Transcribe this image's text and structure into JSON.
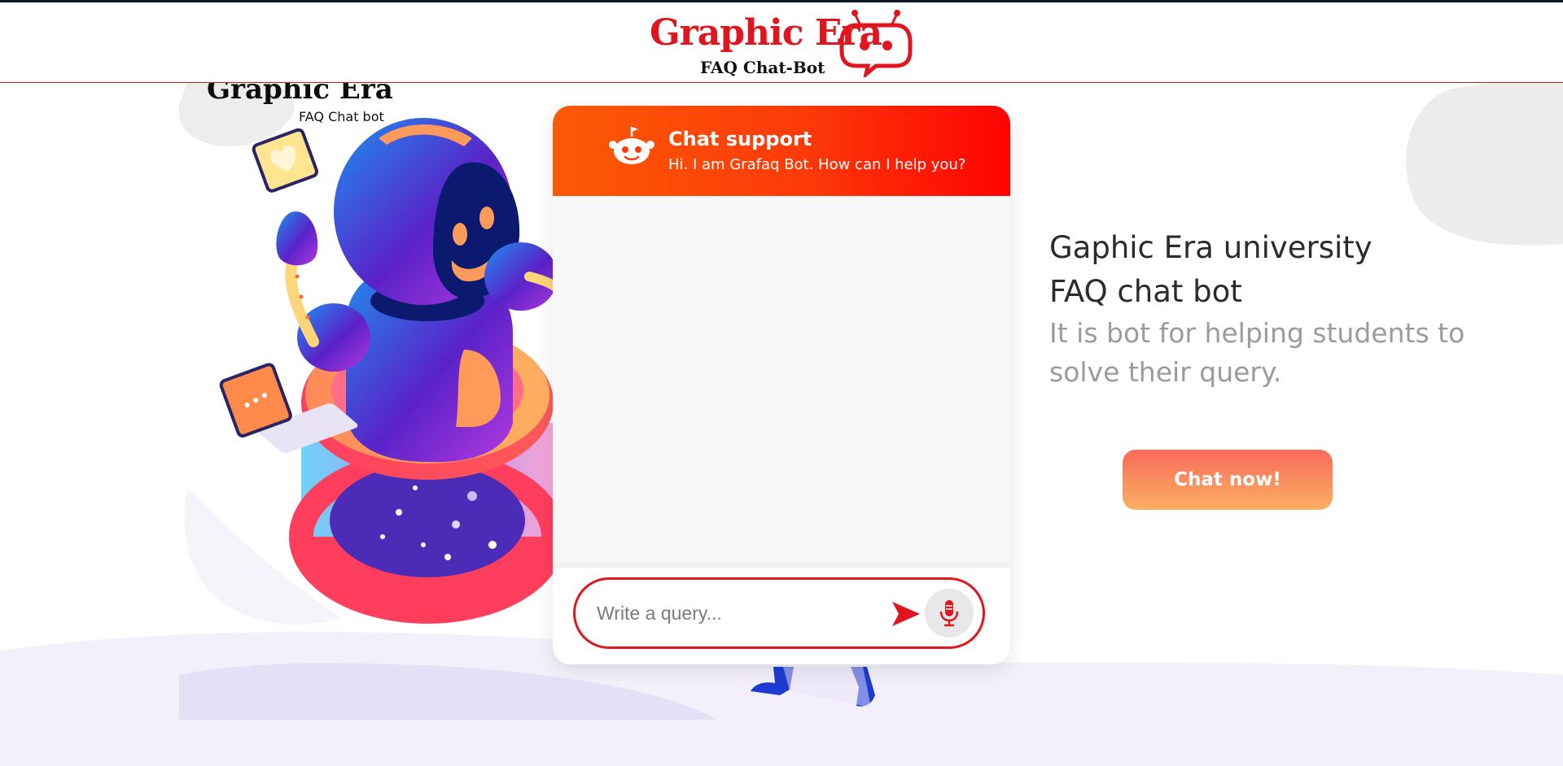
{
  "header": {
    "logo_title": "Graphic Era",
    "logo_subtitle": "FAQ Chat-Bot",
    "brand_color": "#e0151e"
  },
  "illustration": {
    "title": "Graphic Era",
    "subtitle": "FAQ Chat bot"
  },
  "chat": {
    "title": "Chat support",
    "greeting": "Hi. I am Grafaq Bot. How can I help you?",
    "input_placeholder": "Write a query...",
    "header_gradient": [
      "#fb5a06",
      "#ff0202"
    ],
    "send_icon": "send-icon",
    "mic_icon": "microphone-icon",
    "bot_icon": "robot-face-icon"
  },
  "info": {
    "title_line1": "Gaphic Era university",
    "title_line2": "FAQ chat bot",
    "description": "It is bot for helping students to solve their query.",
    "cta_label": "Chat now!",
    "cta_gradient": [
      "#f96a5a",
      "#fbb063"
    ]
  }
}
